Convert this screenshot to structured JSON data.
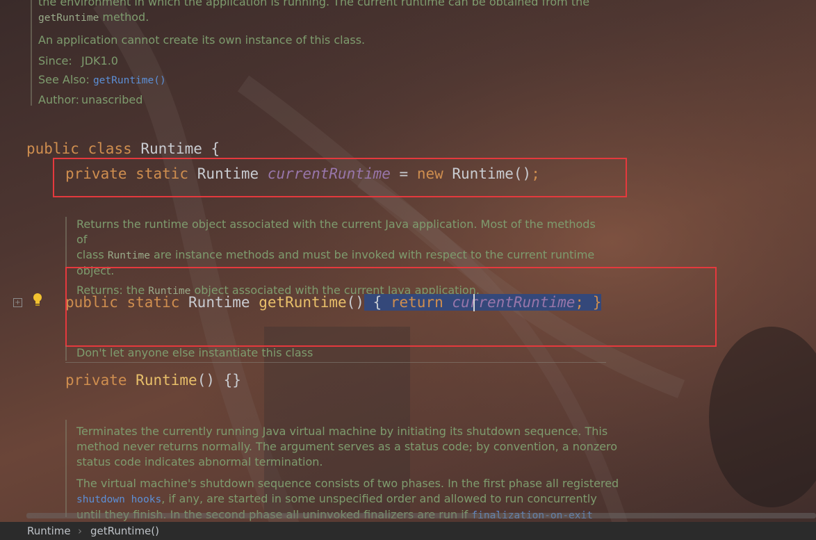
{
  "doc_top": {
    "line1": "the environment in which the application is running. The current runtime can be obtained from the",
    "line2_code": "getRuntime",
    "line2_rest": " method.",
    "line3": "An application cannot create its own instance of this class.",
    "since_label": "Since:",
    "since_value": "JDK1.0",
    "see_also_label": "See Also:",
    "see_also_link": "getRuntime()",
    "author_label": "Author:",
    "author_value": "unascribed"
  },
  "code": {
    "class_kw1": "public",
    "class_kw2": "class",
    "class_name": "Runtime",
    "class_brace": " {",
    "field_kw1": "private",
    "field_kw2": "static",
    "field_type": "Runtime",
    "field_name": "currentRuntime",
    "field_eq": " = ",
    "field_new": "new",
    "field_ctor": " Runtime()",
    "field_semi": ";",
    "method_kw1": "public",
    "method_kw2": "static",
    "method_type": "Runtime",
    "method_name": "getRuntime",
    "method_parens": "()",
    "method_body_open": " { ",
    "method_return": "return",
    "method_body_field": "currentRuntime",
    "method_body_close": "; }",
    "ctor_kw": "private",
    "ctor_name": "Runtime",
    "ctor_rest": "() {}"
  },
  "doc_method": {
    "line1": "Returns the runtime object associated with the current Java application. Most of the methods of",
    "line2_pre": "class ",
    "line2_code": "Runtime",
    "line2_post": " are instance methods and must be invoked with respect to the current runtime",
    "line3": "object.",
    "returns_pre": "Returns: the ",
    "returns_code": "Runtime",
    "returns_post": " object associated with the current Java application."
  },
  "doc_ctor": {
    "line1": "Don't let anyone else instantiate this class"
  },
  "doc_exit": {
    "line1": "Terminates the currently running Java virtual machine by initiating its shutdown sequence. This",
    "line2": "method never returns normally. The argument serves as a status code; by convention, a nonzero",
    "line3": "status code indicates abnormal termination.",
    "line4": "The virtual machine's shutdown sequence consists of two phases. In the first phase all registered",
    "line5_link": "shutdown hooks",
    "line5_rest": ", if any, are started in some unspecified order and allowed to run concurrently",
    "line6_pre": "until they finish. In the second phase all uninvoked finalizers are run if ",
    "line6_link": "finalization-on-exit"
  },
  "breadcrumb": {
    "item1": "Runtime",
    "item2": "getRuntime()"
  },
  "colors": {
    "keyword": "#cf8e4f",
    "field": "#9876aa",
    "method": "#e8bf6a",
    "doc_text": "#7e9c6e",
    "highlight_box": "#e5393d",
    "selection": "#34487a"
  }
}
